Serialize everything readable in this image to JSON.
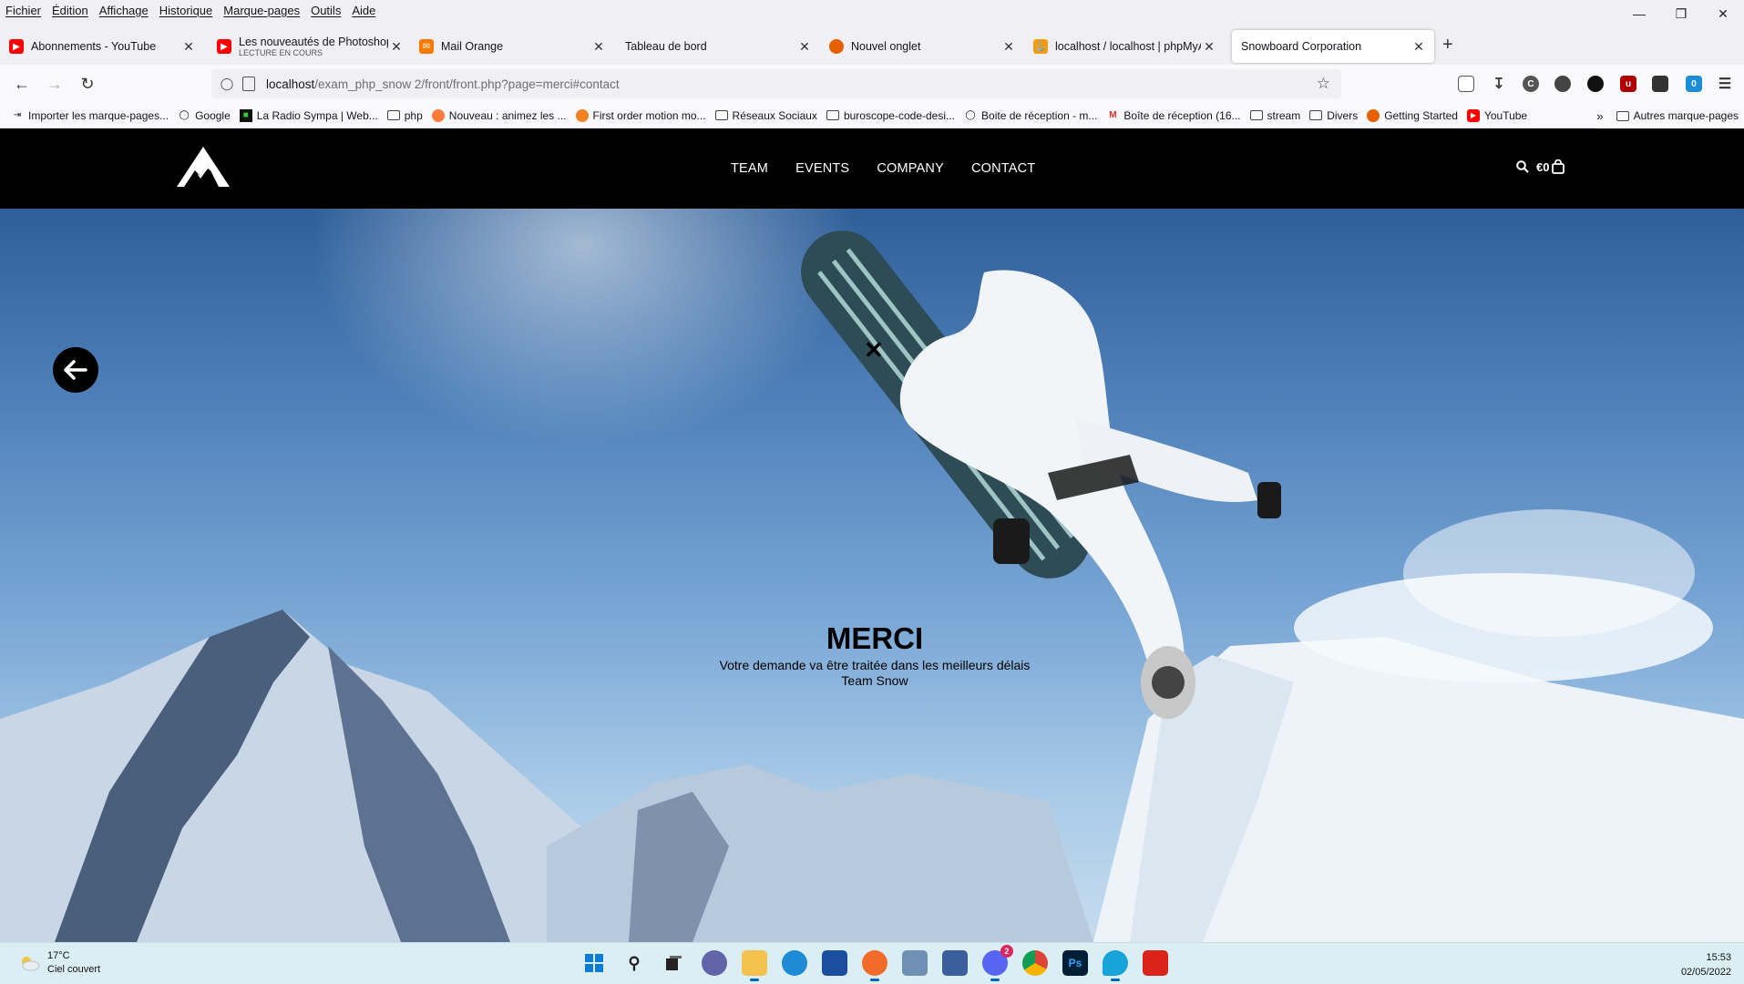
{
  "menu": [
    "Fichier",
    "Édition",
    "Affichage",
    "Historique",
    "Marque-pages",
    "Outils",
    "Aide"
  ],
  "tabs": [
    {
      "title": "Abonnements - YouTube",
      "sub": "",
      "icon": "youtube-icon",
      "color": "#ff0000"
    },
    {
      "title": "Les nouveautés de Photoshop C",
      "sub": "LECTURE EN COURS",
      "icon": "youtube-icon",
      "color": "#ff0000"
    },
    {
      "title": "Mail Orange",
      "sub": "",
      "icon": "mail-icon",
      "color": "#ff7900"
    },
    {
      "title": "Tableau de bord",
      "sub": "",
      "icon": "",
      "color": ""
    },
    {
      "title": "Nouvel onglet",
      "sub": "",
      "icon": "firefox-icon",
      "color": "#e66000"
    },
    {
      "title": "localhost / localhost | phpMyAc",
      "sub": "",
      "icon": "phpmyadmin-icon",
      "color": "#f89c0e"
    },
    {
      "title": "Snowboard Corporation",
      "sub": "",
      "icon": "",
      "color": ""
    }
  ],
  "address": {
    "host": "localhost",
    "path": "/exam_php_snow 2/front/front.php?page=merci#contact"
  },
  "bookmarks": [
    {
      "label": "Importer les marque-pages...",
      "icon": "import-icon"
    },
    {
      "label": "Google",
      "icon": "globe-icon"
    },
    {
      "label": "La Radio Sympa | Web...",
      "icon": "radio-icon"
    },
    {
      "label": "php",
      "icon": "folder-icon"
    },
    {
      "label": "Nouveau : animez les ...",
      "icon": "site-icon"
    },
    {
      "label": "First order motion mo...",
      "icon": "site-icon"
    },
    {
      "label": "Réseaux Sociaux",
      "icon": "folder-icon"
    },
    {
      "label": "buroscope-code-desi...",
      "icon": "folder-icon"
    },
    {
      "label": "Boite de réception - m...",
      "icon": "globe-icon"
    },
    {
      "label": "Boîte de réception (16...",
      "icon": "gmail-icon"
    },
    {
      "label": "stream",
      "icon": "folder-icon"
    },
    {
      "label": "Divers",
      "icon": "folder-icon"
    },
    {
      "label": "Getting Started",
      "icon": "firefox-icon"
    },
    {
      "label": "YouTube",
      "icon": "youtube-icon"
    }
  ],
  "bookmarks_other": "Autres marque-pages",
  "site": {
    "nav": [
      "TEAM",
      "EVENTS",
      "COMPANY",
      "CONTACT"
    ],
    "cart": "€0",
    "close_glyph": "✕",
    "title": "MERCI",
    "line1": "Votre demande va être traitée dans les meilleurs délais",
    "line2": "Team Snow"
  },
  "taskbar": {
    "temp": "17°C",
    "weather": "Ciel couvert",
    "time": "15:53",
    "date": "02/05/2022",
    "discord_badge": "2"
  },
  "ext_badge": "0"
}
